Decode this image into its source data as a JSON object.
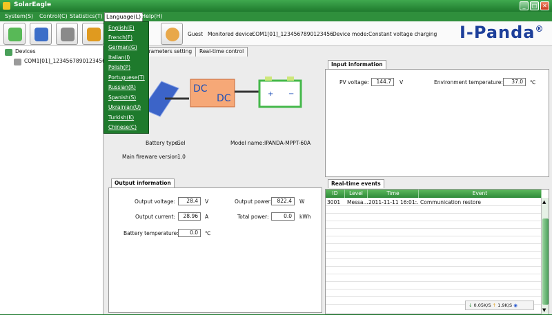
{
  "window": {
    "title": "SolarEagle"
  },
  "menu": {
    "items": [
      "System(S)",
      "Control(C)",
      "Statistics(T)",
      "Language(L)",
      "Help(H)"
    ]
  },
  "language_menu": {
    "items": [
      "English(E)",
      "French(F)",
      "German(G)",
      "Italian(I)",
      "Polish(P)",
      "Portuguese(T)",
      "Russian(R)",
      "Spanish(S)",
      "Ukrainian(U)",
      "Turkish(K)",
      "Chinese(C)"
    ]
  },
  "toolbar": {
    "user": "Guest",
    "monitored_device_label": "Monitored device:",
    "monitored_device": "COM1[01]_1234567890123456",
    "device_mode_label": "Device mode:",
    "device_mode": "Constant voltage charging",
    "brand": "I-Panda",
    "brand_mark": "®"
  },
  "tree": {
    "root": "Devices",
    "child": "COM1[01]_1234567890123456"
  },
  "tabs": [
    "arameters setting",
    "Real-time control"
  ],
  "device_info": {
    "dc_top": "DC",
    "dc_bottom": "DC",
    "battery_type_label": "Battery type:",
    "battery_type": "Gel",
    "model_name_label": "Model name:",
    "model_name": "IPANDA-MPPT-60A",
    "firmware_label": "Main fireware version:",
    "firmware": "1.0"
  },
  "input_info": {
    "title": "Input information",
    "pv_voltage_label": "PV voltage:",
    "pv_voltage": "144.7",
    "pv_voltage_unit": "V",
    "env_temp_label": "Environment temperature:",
    "env_temp": "37.0",
    "env_temp_unit": "℃"
  },
  "output_info": {
    "title": "Output information",
    "output_voltage_label": "Output voltage:",
    "output_voltage": "28.4",
    "output_voltage_unit": "V",
    "output_power_label": "Output power:",
    "output_power": "822.4",
    "output_power_unit": "W",
    "output_current_label": "Output current:",
    "output_current": "28.96",
    "output_current_unit": "A",
    "total_power_label": "Total power:",
    "total_power": "0.0",
    "total_power_unit": "kWh",
    "battery_temp_label": "Battery temperature:",
    "battery_temp": "0.0",
    "battery_temp_unit": "℃"
  },
  "events": {
    "title": "Real-time events",
    "columns": [
      "ID",
      "Level",
      "Time",
      "Event"
    ],
    "rows": [
      [
        "3001",
        "Messa...",
        "2011-11-11 16:01:...",
        "Communication restore"
      ]
    ]
  },
  "net_widget": {
    "down": "0.05K/S",
    "up": "1.9K/S"
  }
}
